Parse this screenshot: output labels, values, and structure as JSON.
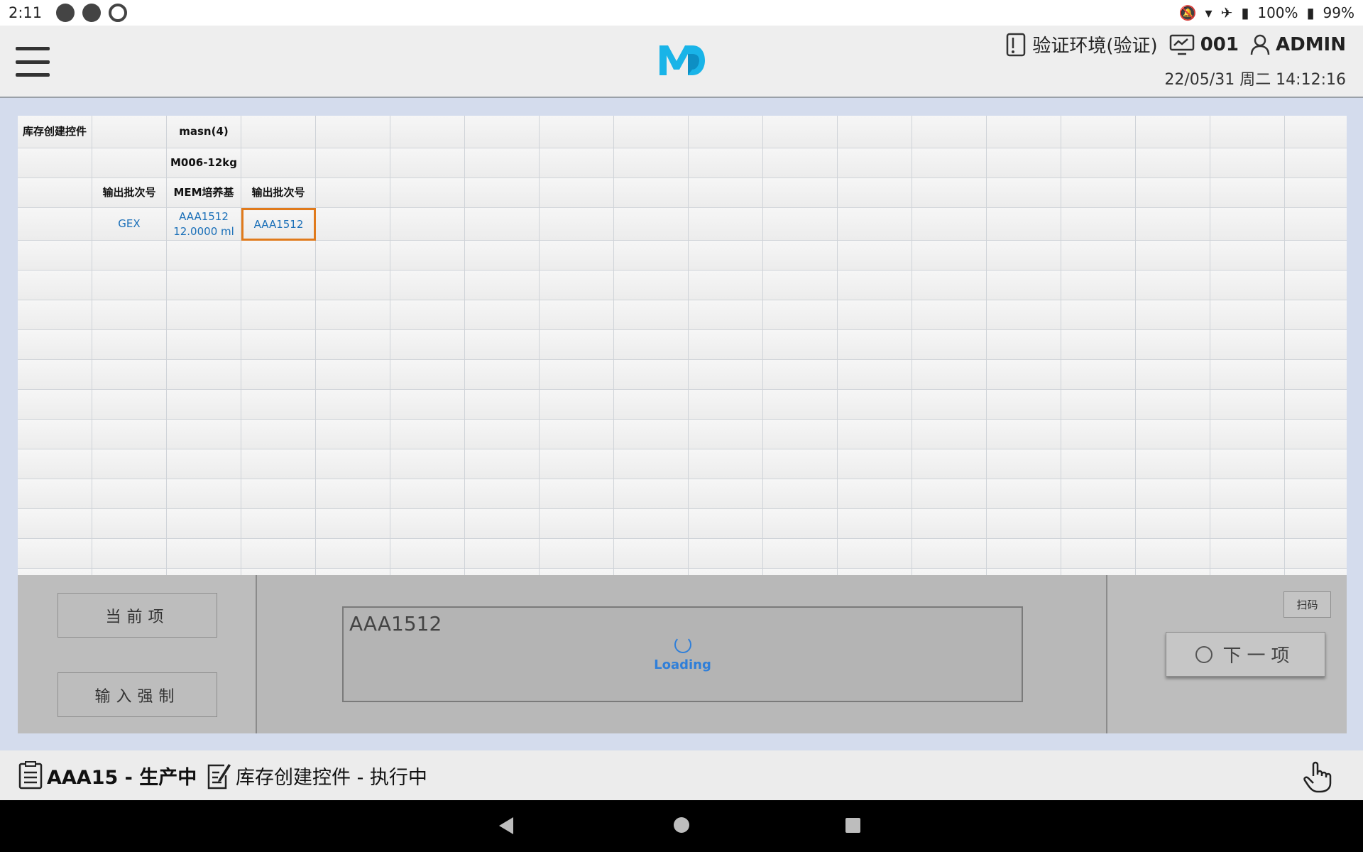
{
  "status_bar": {
    "time": "2:11",
    "battery_text_1": "100%",
    "battery_text_2": "99%"
  },
  "header": {
    "environment": "验证环境(验证)",
    "terminal": "001",
    "user": "ADMIN",
    "datetime": "22/05/31 周二 14:12:16"
  },
  "grid": {
    "rows": [
      [
        "库存创建控件",
        "",
        "masn(4)",
        ""
      ],
      [
        "",
        "",
        "M006-12kg",
        ""
      ],
      [
        "",
        "输出批次号",
        "MEM培养基",
        "输出批次号"
      ],
      [
        "",
        "GEX",
        "AAA1512 12.0000 ml",
        "AAA1512"
      ]
    ],
    "selected_value": "AAA1512"
  },
  "panel": {
    "current_label": "当前项",
    "force_label": "输入强制",
    "input_value": "AAA1512",
    "loading_label": "Loading",
    "scan_label": "扫码",
    "next_label": "下一项"
  },
  "footer": {
    "order_status": "AAA15 - 生产中",
    "step_status": "库存创建控件 - 执行中"
  },
  "colors": {
    "accent": "#2f7fd9",
    "selection": "#e07a1c",
    "link_value": "#1a6fb8",
    "logo": "#19b4e8"
  }
}
